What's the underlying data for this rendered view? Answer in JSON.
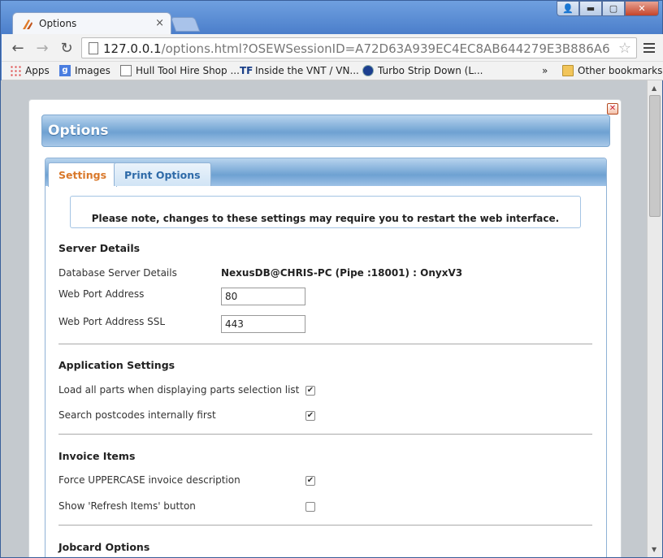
{
  "browser": {
    "tab_title": "Options",
    "tab_close": "×",
    "window_buttons": {
      "user": "👤",
      "minimize": "▬",
      "maximize": "▢",
      "close": "✕"
    },
    "url_host": "127.0.0.1",
    "url_path": "/options.html?OSEWSessionID=A72D63A939EC4EC8AB644279E3B886A6",
    "star": "☆",
    "back": "←",
    "forward": "→",
    "reload": "↻"
  },
  "bookmarks": {
    "items": [
      {
        "label": "Apps",
        "icon": "apps-grid-icon"
      },
      {
        "label": "Images",
        "icon": "google-icon"
      },
      {
        "label": "Hull Tool Hire Shop ...",
        "icon": "page-icon"
      },
      {
        "label": "Inside the VNT / VN...",
        "icon": "tf-icon"
      },
      {
        "label": "Turbo Strip Down (L...",
        "icon": "ford-icon"
      }
    ],
    "overflow": "»",
    "other": "Other bookmarks"
  },
  "dialog": {
    "close_glyph": "✕",
    "title": "Options",
    "tabs": [
      {
        "label": "Settings",
        "active": true
      },
      {
        "label": "Print Options",
        "active": false
      }
    ],
    "notice": "Please note, changes to these settings may require you to restart the web interface.",
    "server": {
      "title": "Server Details",
      "db_label": "Database Server Details",
      "db_value": "NexusDB@CHRIS-PC (Pipe :18001) : OnyxV3",
      "port_label": "Web Port Address",
      "port_value": "80",
      "ssl_label": "Web Port Address SSL",
      "ssl_value": "443"
    },
    "application": {
      "title": "Application Settings",
      "load_parts_label": "Load all parts when displaying parts selection list",
      "load_parts_checked": true,
      "postcodes_label": "Search postcodes internally first",
      "postcodes_checked": true
    },
    "invoice": {
      "title": "Invoice Items",
      "uppercase_label": "Force UPPERCASE invoice description",
      "uppercase_checked": true,
      "refresh_label": "Show 'Refresh Items' button",
      "refresh_checked": false
    },
    "jobcard": {
      "title": "Jobcard Options"
    },
    "check_glyph": "✔"
  }
}
